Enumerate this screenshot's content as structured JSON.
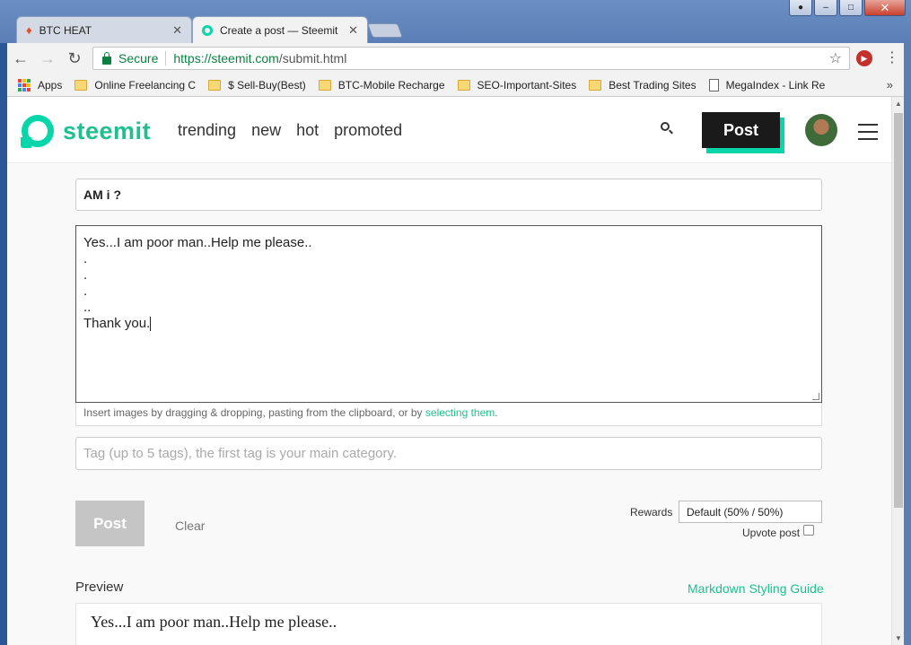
{
  "browser": {
    "tabs": [
      {
        "title": "BTC HEAT",
        "active": false
      },
      {
        "title": "Create a post — Steemit",
        "active": true
      }
    ],
    "window_controls": {
      "minimize": "‒",
      "maximize": "□",
      "close": "✕"
    },
    "address": {
      "secure_label": "Secure",
      "url_host": "https://steemit.com",
      "url_path": "/submit.html"
    },
    "bookmarks": [
      {
        "label": "Apps",
        "icon": "apps-grid-icon"
      },
      {
        "label": "Online Freelancing C",
        "icon": "folder-icon"
      },
      {
        "label": "$ Sell-Buy(Best)",
        "icon": "folder-icon"
      },
      {
        "label": "BTC-Mobile Recharge",
        "icon": "folder-icon"
      },
      {
        "label": "SEO-Important-Sites",
        "icon": "folder-icon"
      },
      {
        "label": "Best Trading Sites",
        "icon": "folder-icon"
      },
      {
        "label": "MegaIndex - Link Re",
        "icon": "page-icon"
      }
    ],
    "bookmarks_more": "»"
  },
  "header": {
    "logo_text": "steemit",
    "nav": [
      "trending",
      "new",
      "hot",
      "promoted"
    ],
    "post_button": "Post"
  },
  "editor": {
    "title_value": "AM i ?",
    "body_lines": [
      "Yes...I am poor man..Help me please..",
      ".",
      ".",
      ".",
      "..",
      "Thank you."
    ],
    "upload_hint_prefix": "Insert images by dragging & dropping, pasting from the clipboard, or by ",
    "upload_hint_link": "selecting them",
    "upload_hint_suffix": ".",
    "tag_placeholder": "Tag (up to 5 tags), the first tag is your main category.",
    "submit_label": "Post",
    "clear_label": "Clear",
    "rewards_label": "Rewards",
    "rewards_value": "Default (50% / 50%)",
    "upvote_label": "Upvote post",
    "upvote_checked": false
  },
  "preview": {
    "label": "Preview",
    "guide_link": "Markdown Styling Guide",
    "content": "Yes...I am poor man..Help me please.."
  },
  "colors": {
    "brand": "#06d6a9",
    "brand_text": "#1fbf8f",
    "secure_green": "#0b8043"
  }
}
